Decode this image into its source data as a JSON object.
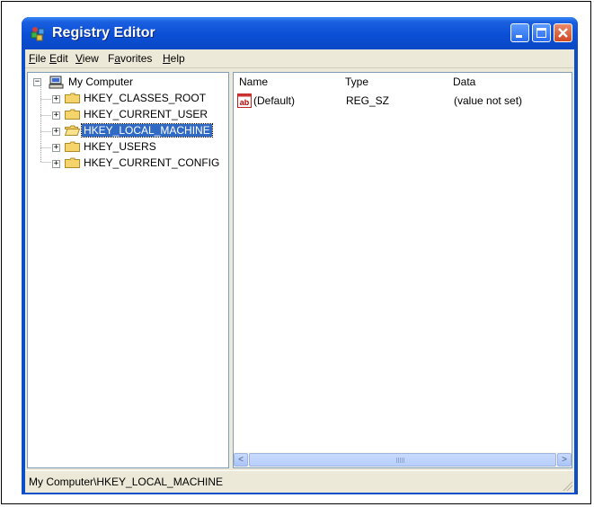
{
  "window": {
    "title": "Registry Editor",
    "min_icon": "minimize-icon",
    "max_icon": "maximize-icon",
    "close_icon": "close-icon"
  },
  "menu": [
    {
      "first": "F",
      "rest": "ile"
    },
    {
      "first": "E",
      "rest": "dit"
    },
    {
      "first": "V",
      "rest": "iew"
    },
    {
      "first": "",
      "pre": "F",
      "u": "a",
      "post": "vorites"
    },
    {
      "first": "H",
      "rest": "elp"
    }
  ],
  "tree": {
    "root": {
      "label": "My Computer",
      "expander": "⊟",
      "icon": "computer-icon"
    },
    "keys": [
      {
        "label": "HKEY_CLASSES_ROOT",
        "expander": "+",
        "icon": "folder-icon"
      },
      {
        "label": "HKEY_CURRENT_USER",
        "expander": "+",
        "icon": "folder-icon"
      },
      {
        "label": "HKEY_LOCAL_MACHINE",
        "expander": "+",
        "icon": "folder-open-icon",
        "selected": true
      },
      {
        "label": "HKEY_USERS",
        "expander": "+",
        "icon": "folder-icon"
      },
      {
        "label": "HKEY_CURRENT_CONFIG",
        "expander": "+",
        "icon": "folder-icon"
      }
    ]
  },
  "list": {
    "columns": [
      "Name",
      "Type",
      "Data"
    ],
    "rows": [
      {
        "icon": "string-value-icon",
        "icon_text": "ab",
        "name": "(Default)",
        "type": "REG_SZ",
        "data": "(value not set)"
      }
    ]
  },
  "scrollbar": {
    "left_arrow": "<",
    "right_arrow": ">"
  },
  "status": {
    "path": "My Computer\\HKEY_LOCAL_MACHINE"
  },
  "colors": {
    "titlebar": "#0a4ec8",
    "selection": "#316ac5",
    "window_bg": "#ece9d8"
  }
}
